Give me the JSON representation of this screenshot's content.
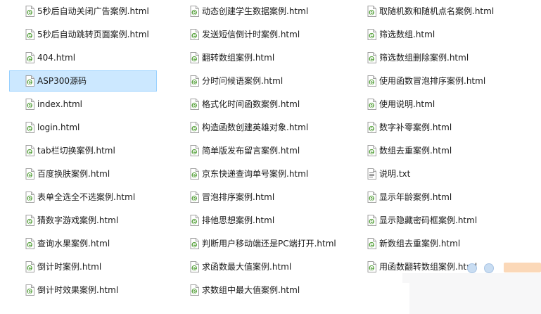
{
  "files": {
    "column_1": [
      {
        "name": "5秒后自动关闭广告案例.html",
        "type": "html"
      },
      {
        "name": "5秒后自动跳转页面案例.html",
        "type": "html"
      },
      {
        "name": "404.html",
        "type": "html"
      },
      {
        "name": "ASP300源码",
        "type": "html",
        "selected": true
      },
      {
        "name": "index.html",
        "type": "html"
      },
      {
        "name": "login.html",
        "type": "html"
      },
      {
        "name": "tab栏切换案例.html",
        "type": "html"
      },
      {
        "name": "百度换肤案例.html",
        "type": "html"
      },
      {
        "name": "表单全选全不选案例.html",
        "type": "html"
      },
      {
        "name": "猜数字游戏案例.html",
        "type": "html"
      },
      {
        "name": "查询水果案例.html",
        "type": "html"
      },
      {
        "name": "倒计时案例.html",
        "type": "html"
      },
      {
        "name": "倒计时效果案例.html",
        "type": "html"
      }
    ],
    "column_2": [
      {
        "name": "动态创建学生数据案例.html",
        "type": "html"
      },
      {
        "name": "发送短信倒计时案例.html",
        "type": "html"
      },
      {
        "name": "翻转数组案例.html",
        "type": "html"
      },
      {
        "name": "分时问候语案例.html",
        "type": "html"
      },
      {
        "name": "格式化时间函数案例.html",
        "type": "html"
      },
      {
        "name": "构造函数创建英雄对象.html",
        "type": "html"
      },
      {
        "name": "简单版发布留言案例.html",
        "type": "html"
      },
      {
        "name": "京东快递查询单号案例.html",
        "type": "html"
      },
      {
        "name": "冒泡排序案例.html",
        "type": "html"
      },
      {
        "name": "排他思想案例.html",
        "type": "html"
      },
      {
        "name": "判断用户移动端还是PC端打开.html",
        "type": "html"
      },
      {
        "name": "求函数最大值案例.html",
        "type": "html"
      },
      {
        "name": "求数组中最大值案例.html",
        "type": "html"
      }
    ],
    "column_3": [
      {
        "name": "取随机数和随机点名案例.html",
        "type": "html"
      },
      {
        "name": "筛选数组.html",
        "type": "html"
      },
      {
        "name": "筛选数组删除案例.html",
        "type": "html"
      },
      {
        "name": "使用函数冒泡排序案例.html",
        "type": "html"
      },
      {
        "name": "使用说明.html",
        "type": "html"
      },
      {
        "name": "数字补零案例.html",
        "type": "html"
      },
      {
        "name": "数组去重案例.html",
        "type": "html"
      },
      {
        "name": "说明.txt",
        "type": "txt"
      },
      {
        "name": "显示年龄案例.html",
        "type": "html"
      },
      {
        "name": "显示隐藏密码框案例.html",
        "type": "html"
      },
      {
        "name": "新数组去重案例.html",
        "type": "html"
      },
      {
        "name": "用函数翻转数组案例.html",
        "type": "html"
      }
    ]
  },
  "colors": {
    "selection_bg": "#cce8ff",
    "selection_border": "#99d1ff",
    "html_icon_accent": "#3c8d2f",
    "text": "#1a1a1a"
  },
  "icons": {
    "html": "html-file-icon",
    "txt": "text-file-icon"
  }
}
